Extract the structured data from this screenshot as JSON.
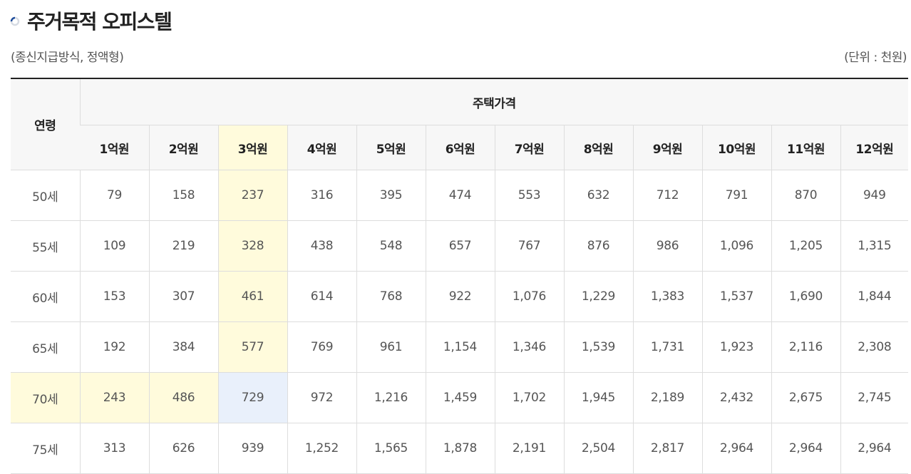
{
  "page": {
    "title": "주거목적 오피스텔",
    "subtitle": "(종신지급방식, 정액형)",
    "unit": "(단위 : 천원)"
  },
  "table": {
    "row_header": "연령",
    "group_header": "주택가격",
    "price_columns": [
      "1억원",
      "2억원",
      "3억원",
      "4억원",
      "5억원",
      "6억원",
      "7억원",
      "8억원",
      "9억원",
      "10억원",
      "11억원",
      "12억원"
    ],
    "rows": [
      {
        "age": "50세",
        "values": [
          "79",
          "158",
          "237",
          "316",
          "395",
          "474",
          "553",
          "632",
          "712",
          "791",
          "870",
          "949"
        ]
      },
      {
        "age": "55세",
        "values": [
          "109",
          "219",
          "328",
          "438",
          "548",
          "657",
          "767",
          "876",
          "986",
          "1,096",
          "1,205",
          "1,315"
        ]
      },
      {
        "age": "60세",
        "values": [
          "153",
          "307",
          "461",
          "614",
          "768",
          "922",
          "1,076",
          "1,229",
          "1,383",
          "1,537",
          "1,690",
          "1,844"
        ]
      },
      {
        "age": "65세",
        "values": [
          "192",
          "384",
          "577",
          "769",
          "961",
          "1,154",
          "1,346",
          "1,539",
          "1,731",
          "1,923",
          "2,116",
          "2,308"
        ]
      },
      {
        "age": "70세",
        "values": [
          "243",
          "486",
          "729",
          "972",
          "1,216",
          "1,459",
          "1,702",
          "1,945",
          "2,189",
          "2,432",
          "2,675",
          "2,745"
        ]
      },
      {
        "age": "75세",
        "values": [
          "313",
          "626",
          "939",
          "1,252",
          "1,565",
          "1,878",
          "2,191",
          "2,504",
          "2,817",
          "2,964",
          "2,964",
          "2,964"
        ]
      }
    ],
    "highlight": {
      "column": "3억원",
      "row": "70세",
      "colors": {
        "highlight": "#fffbdc",
        "intersection": "#e9f0fb"
      }
    }
  },
  "icons": {
    "title_marker": "spinner-circle-icon"
  },
  "colors": {
    "header_bg": "#f7f7f7",
    "border": "#dddddd",
    "top_rule": "#222222"
  }
}
